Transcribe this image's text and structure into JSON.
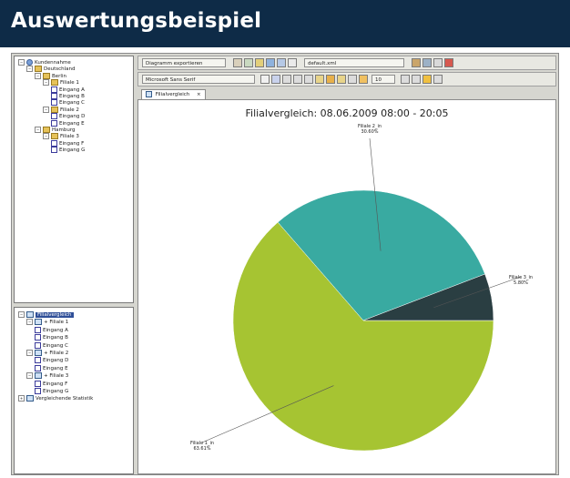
{
  "banner": {
    "title": "Auswertungsbeispiel"
  },
  "colors": {
    "banner_bg": "#0e2b47",
    "slice_1": "#a6c432",
    "slice_2": "#39aaa1",
    "slice_3": "#2a3e42",
    "selection": "#2f4f98"
  },
  "tree_top": {
    "items": [
      {
        "label": "Kundennahme",
        "icon": "globe-icon"
      },
      {
        "label": "Deutschland",
        "icon": "folder-icon"
      },
      {
        "label": "Berlin",
        "icon": "folder-icon"
      },
      {
        "label": "Filiale 1",
        "icon": "folder-icon"
      },
      {
        "label": "Eingang A",
        "icon": "entrance-icon"
      },
      {
        "label": "Eingang B",
        "icon": "entrance-icon"
      },
      {
        "label": "Eingang C",
        "icon": "entrance-icon"
      },
      {
        "label": "Filiale 2",
        "icon": "folder-icon"
      },
      {
        "label": "Eingang D",
        "icon": "entrance-icon"
      },
      {
        "label": "Eingang E",
        "icon": "entrance-icon"
      },
      {
        "label": "Hamburg",
        "icon": "folder-icon"
      },
      {
        "label": "Filiale 3",
        "icon": "folder-icon"
      },
      {
        "label": "Eingang F",
        "icon": "entrance-icon"
      },
      {
        "label": "Eingang G",
        "icon": "entrance-icon"
      }
    ]
  },
  "tree_bottom": {
    "items": [
      {
        "label": "Filialvergleich",
        "icon": "chart-icon"
      },
      {
        "label": "+ Filiale 1",
        "icon": "sum-icon"
      },
      {
        "label": "Eingang A",
        "icon": "entrance-icon"
      },
      {
        "label": "Eingang B",
        "icon": "entrance-icon"
      },
      {
        "label": "Eingang C",
        "icon": "entrance-icon"
      },
      {
        "label": "+ Filiale 2",
        "icon": "sum-icon"
      },
      {
        "label": "Eingang D",
        "icon": "entrance-icon"
      },
      {
        "label": "Eingang E",
        "icon": "entrance-icon"
      },
      {
        "label": "+ Filiale 3",
        "icon": "sum-icon"
      },
      {
        "label": "Eingang F",
        "icon": "entrance-icon"
      },
      {
        "label": "Eingang G",
        "icon": "entrance-icon"
      },
      {
        "label": "Vergleichende Statistik",
        "icon": "statistics-icon"
      }
    ]
  },
  "toolbar": {
    "export_button": "Diagramm exportieren",
    "style_select": "default.xml",
    "font_select": "Microsoft Sans Serif",
    "font_size": "10"
  },
  "tab": {
    "label": "Filialvergleich"
  },
  "chart_data": {
    "type": "pie",
    "title": "Filialvergleich: 08.06.2009 08:00 - 20:05",
    "slices": [
      {
        "label": "Filiale 1_in",
        "percent_label": "63.61%",
        "value": 63.61,
        "color": "#a6c432"
      },
      {
        "label": "Filiale 2_in",
        "percent_label": "30.60%",
        "value": 30.6,
        "color": "#39aaa1"
      },
      {
        "label": "Filiale 3_in",
        "percent_label": "5.80%",
        "value": 5.8,
        "color": "#2a3e42"
      }
    ]
  }
}
